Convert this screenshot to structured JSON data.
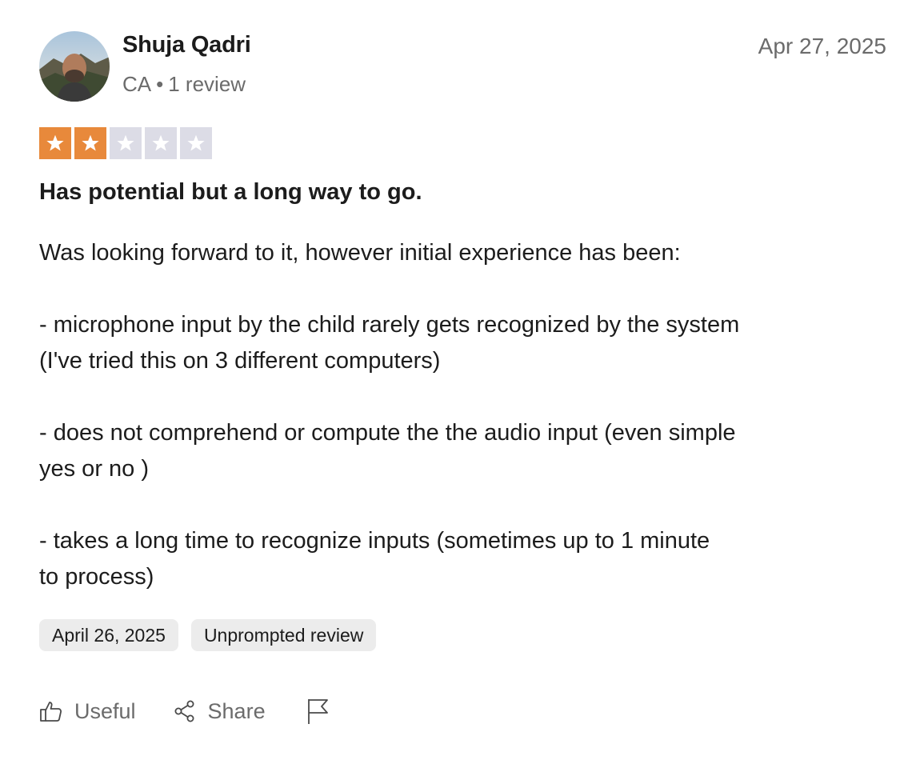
{
  "reviewer": {
    "name": "Shuja Qadri",
    "country": "CA",
    "separator": "•",
    "review_count": "1 review"
  },
  "review": {
    "date": "Apr 27, 2025",
    "rating": 2,
    "rating_max": 5,
    "title": "Has potential but a long way to go.",
    "body": "Was looking forward to it, however initial experience has been:\n\n- microphone input by the child rarely gets recognized by the system\n(I've tried this on 3 different computers)\n\n- does not comprehend or compute the the audio input (even simple\nyes or no )\n\n- takes a long time to recognize inputs (sometimes up to 1 minute\nto process)",
    "tags": [
      "April 26, 2025",
      "Unprompted review"
    ]
  },
  "actions": {
    "useful_label": "Useful",
    "share_label": "Share"
  },
  "colors": {
    "star_on": "#e8893b",
    "star_off": "#dcdce6",
    "muted_text": "#6b6b6b",
    "tag_bg": "#ececec"
  },
  "icons": [
    "thumbs-up-icon",
    "share-icon",
    "flag-icon",
    "star-icon"
  ]
}
